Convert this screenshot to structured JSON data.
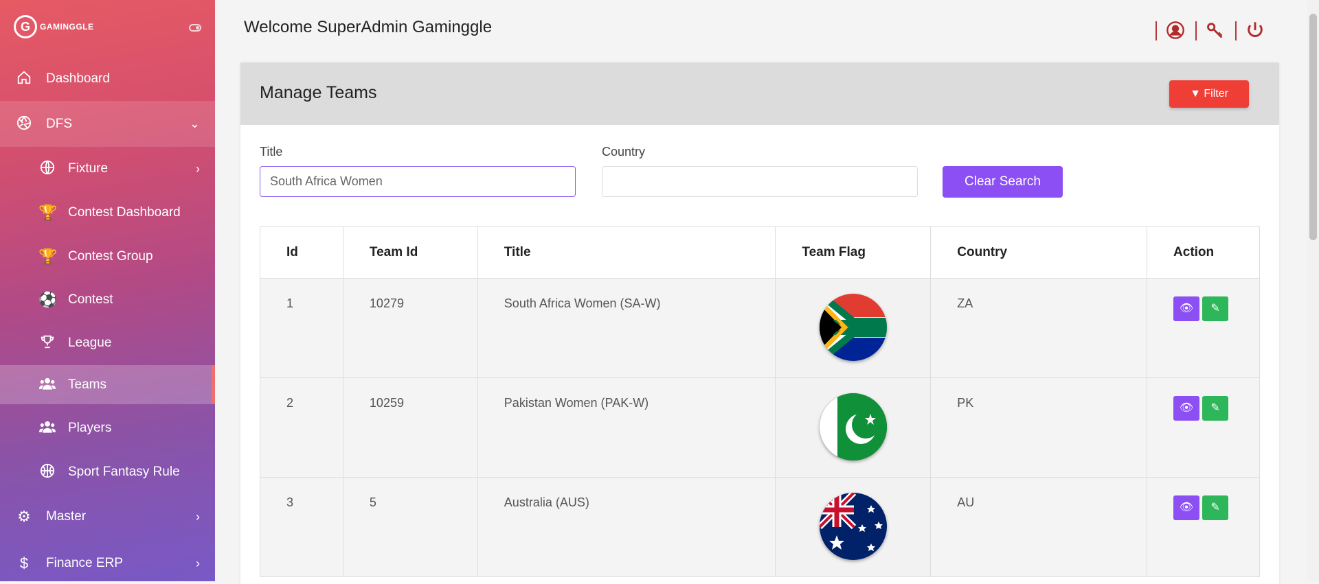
{
  "app": {
    "logo_letter": "G",
    "logo_text": "GAMINGGLE"
  },
  "sidebar": {
    "items": [
      {
        "label": "Dashboard",
        "icon": "home-icon"
      },
      {
        "label": "DFS",
        "icon": "aperture-icon"
      },
      {
        "label": "Fixture",
        "icon": "globe-icon"
      },
      {
        "label": "Contest Dashboard",
        "icon": "trophy-icon"
      },
      {
        "label": "Contest Group",
        "icon": "trophy-icon"
      },
      {
        "label": "Contest",
        "icon": "soccer-ball-icon"
      },
      {
        "label": "League",
        "icon": "trophy-outline-icon"
      },
      {
        "label": "Teams",
        "icon": "users-icon"
      },
      {
        "label": "Players",
        "icon": "users-icon"
      },
      {
        "label": "Sport Fantasy Rule",
        "icon": "basketball-icon"
      },
      {
        "label": "Master",
        "icon": "gears-icon"
      },
      {
        "label": "Finance ERP",
        "icon": "dollar-icon"
      }
    ]
  },
  "header": {
    "welcome": "Welcome SuperAdmin Gaminggle"
  },
  "page": {
    "title": "Manage Teams",
    "filter_label": "Filter",
    "title_label": "Title",
    "title_value": "South Africa Women",
    "country_label": "Country",
    "country_value": "",
    "clear_label": "Clear Search"
  },
  "table": {
    "headers": [
      "Id",
      "Team Id",
      "Title",
      "Team Flag",
      "Country",
      "Action"
    ],
    "rows": [
      {
        "id": "1",
        "team_id": "10279",
        "title": "South Africa Women (SA-W)",
        "flag": "south-africa-flag-icon",
        "country": "ZA"
      },
      {
        "id": "2",
        "team_id": "10259",
        "title": "Pakistan Women (PAK-W)",
        "flag": "pakistan-flag-icon",
        "country": "PK"
      },
      {
        "id": "3",
        "team_id": "5",
        "title": "Australia (AUS)",
        "flag": "australia-flag-icon",
        "country": "AU"
      }
    ]
  },
  "colors": {
    "filter": "#ef3e36",
    "clear": "#8c4ff4",
    "view": "#8c4ff4",
    "edit": "#2db75a"
  }
}
